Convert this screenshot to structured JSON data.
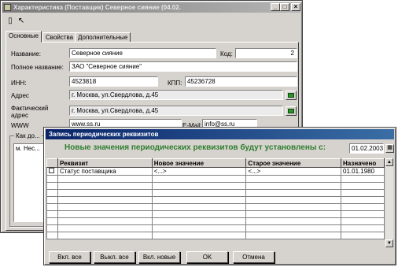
{
  "main_window": {
    "title": "Характеристика (Поставщик) Северное сияние (04.02.",
    "tabs": [
      "Основные",
      "Свойства",
      "Дополнительные"
    ],
    "labels": {
      "name": "Название:",
      "code": "Код:",
      "full_name": "Полное название:",
      "inn": "ИНН:",
      "kpp": "КПП:",
      "address": "Адрес",
      "actual_address_1": "Фактический",
      "actual_address_2": "адрес",
      "www": "WWW",
      "email": "E-Mail:",
      "contact": "Как до...",
      "list_item": "м. Нес..."
    },
    "values": {
      "name": "Северное сияние",
      "code": "2",
      "full_name": "ЗАО \"Северное сияние\"",
      "inn": "4523818",
      "kpp": "45236728",
      "address": "г. Москва, ул.Свердлова, д.45",
      "actual_address": "г. Москва, ул.Свердлова, д.45",
      "www": "www.ss.ru",
      "email": "info@ss.ru"
    }
  },
  "dialog": {
    "title": "Запись периодических реквизитов",
    "heading": "Новые значения периодических реквизитов будут установлены с:",
    "date": "01.02.2003",
    "columns": [
      "Реквизит",
      "Новое значение",
      "Старое значение",
      "Назначено"
    ],
    "rows": [
      {
        "name": "Статус поставщика",
        "new": "<...>",
        "old": "<...>",
        "assigned": "01.01.1980"
      }
    ],
    "buttons": [
      "Вкл. все",
      "Выкл. все",
      "Вкл. новые",
      "OK",
      "Отмена"
    ]
  }
}
